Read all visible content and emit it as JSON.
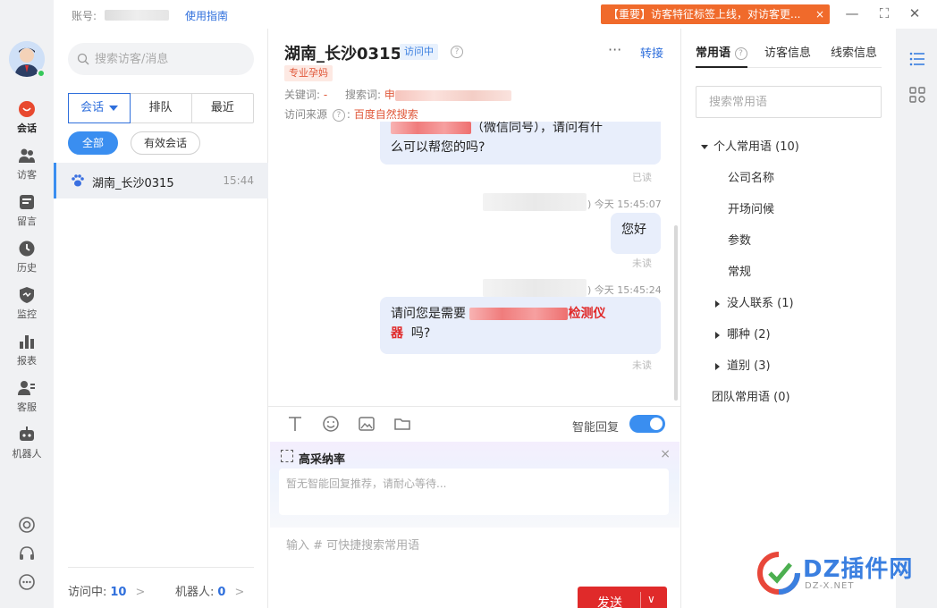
{
  "topbar": {
    "account_label": "账号:",
    "guide_link": "使用指南",
    "notice": "【重要】访客特征标签上线，对访客更...",
    "notice_close": "×",
    "minimize": "—",
    "maximize": "⛶",
    "close": "✕"
  },
  "nav": {
    "items": [
      {
        "label": "会话",
        "icon": "chat-bubble-icon",
        "active": true
      },
      {
        "label": "访客",
        "icon": "visitors-icon"
      },
      {
        "label": "留言",
        "icon": "message-icon"
      },
      {
        "label": "历史",
        "icon": "clock-icon"
      },
      {
        "label": "监控",
        "icon": "shield-icon"
      },
      {
        "label": "报表",
        "icon": "bar-chart-icon"
      },
      {
        "label": "客服",
        "icon": "agent-icon"
      },
      {
        "label": "机器人",
        "icon": "robot-icon"
      }
    ],
    "bottom_icons": [
      "target-icon",
      "headset-icon",
      "more-icon"
    ]
  },
  "convlist": {
    "search_placeholder": "搜索访客/消息",
    "tabs": [
      "会话",
      "排队",
      "最近"
    ],
    "chips": [
      "全部",
      "有效会话"
    ],
    "row": {
      "name": "湖南_长沙0315",
      "time": "15:44"
    },
    "footer": {
      "visiting_label": "访问中:",
      "visiting_count": "10",
      "robot_label": "机器人:",
      "robot_count": "0",
      "chevron": ">"
    }
  },
  "chat": {
    "title": "湖南_长沙0315",
    "status_badge": "访问中",
    "help": "?",
    "more": "···",
    "transfer": "转接",
    "tag": "专业孕妈",
    "keyword_label": "关键词:",
    "keyword_value": "-",
    "search_word_label": "搜索词:",
    "search_word_prefix": "申",
    "source_label": "访问来源",
    "source_value": "百度自然搜索",
    "messages": {
      "m1_line1_prefix": "（微信同号），请问有什",
      "m1_line2": "么可以帮您的吗?",
      "m1_status": "已读",
      "m2_stamp": ") 今天 15:45:07",
      "m2_text": "您好",
      "m2_status": "未读",
      "m3_stamp": ") 今天 15:45:24",
      "m3_text_a": "请问您是需要",
      "m3_text_red": "检测仪",
      "m3_text_red2": "器",
      "m3_text_b": "吗?",
      "m3_status": "未读"
    },
    "smart_reply_label": "智能回复",
    "recommend_title": "高采纳率",
    "recommend_close": "×",
    "recommend_placeholder": "暂无智能回复推荐，请耐心等待...",
    "input_placeholder": "输入 # 可快捷搜索常用语",
    "send_label": "发送",
    "send_arrow": "∨"
  },
  "rpanel": {
    "tabs": [
      "常用语",
      "访客信息",
      "线索信息"
    ],
    "help": "?",
    "search_placeholder": "搜索常用语",
    "tree": {
      "personal": "个人常用语 (10)",
      "items": [
        "公司名称",
        "开场问候",
        "参数",
        "常规"
      ],
      "groups": [
        "没人联系 (1)",
        "哪种 (2)",
        "道别 (3)"
      ],
      "team": "团队常用语 (0)"
    }
  },
  "watermark": {
    "text": "DZ插件网",
    "sub": "DZ-X.NET"
  },
  "colors": {
    "accent": "#3a8ef0",
    "link": "#2f6fdc",
    "notice": "#f06a2b",
    "send": "#e02a2a",
    "tag": "#e0583a"
  }
}
